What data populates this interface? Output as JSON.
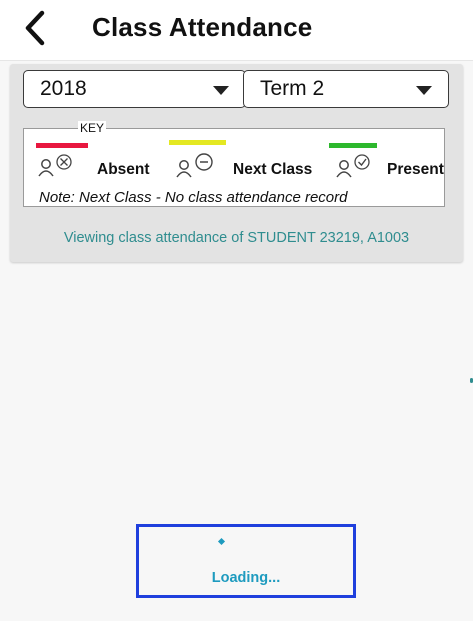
{
  "header": {
    "back_icon": "chevron-left-icon",
    "title": "Class Attendance"
  },
  "filters": {
    "year": {
      "value": "2018"
    },
    "term": {
      "value": "Term 2"
    }
  },
  "key": {
    "label": "KEY",
    "items": [
      {
        "label": "Absent",
        "color": "#e8173f",
        "icon": "person-cross-icon"
      },
      {
        "label": "Next Class",
        "color": "#e4e822",
        "icon": "person-minus-icon"
      },
      {
        "label": "Present",
        "color": "#2db82d",
        "icon": "person-check-icon"
      }
    ],
    "note": "Note: Next Class - No class attendance record"
  },
  "viewing_text": "Viewing class attendance of STUDENT  23219, A1003",
  "loading": {
    "text": "Loading..."
  },
  "colors": {
    "accent": "#2f8d8f",
    "loading": "#1e9bbf",
    "highlight_border": "#1f3fdd"
  }
}
